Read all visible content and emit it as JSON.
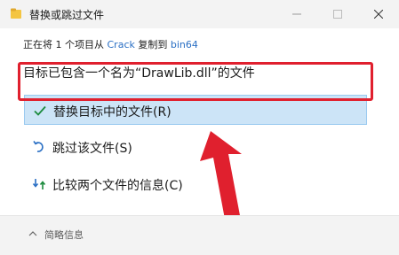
{
  "window": {
    "title": "替换或跳过文件"
  },
  "status": {
    "prefix": "正在将 1 个项目从",
    "source": "Crack",
    "middle": "复制到",
    "destination": "bin64"
  },
  "headline": "目标已包含一个名为“DrawLib.dll”的文件",
  "options": [
    {
      "label": "替换目标中的文件(R)",
      "icon": "checkmark-icon",
      "selected": true
    },
    {
      "label": "跳过该文件(S)",
      "icon": "skip-arrow-icon",
      "selected": false
    },
    {
      "label": "比较两个文件的信息(C)",
      "icon": "compare-icon",
      "selected": false
    }
  ],
  "footer": {
    "label": "简略信息"
  },
  "colors": {
    "accent": "#2a6fc4",
    "selection_bg": "#cce4f7",
    "highlight_red": "#e0202e",
    "check_green": "#1a8a3c"
  }
}
